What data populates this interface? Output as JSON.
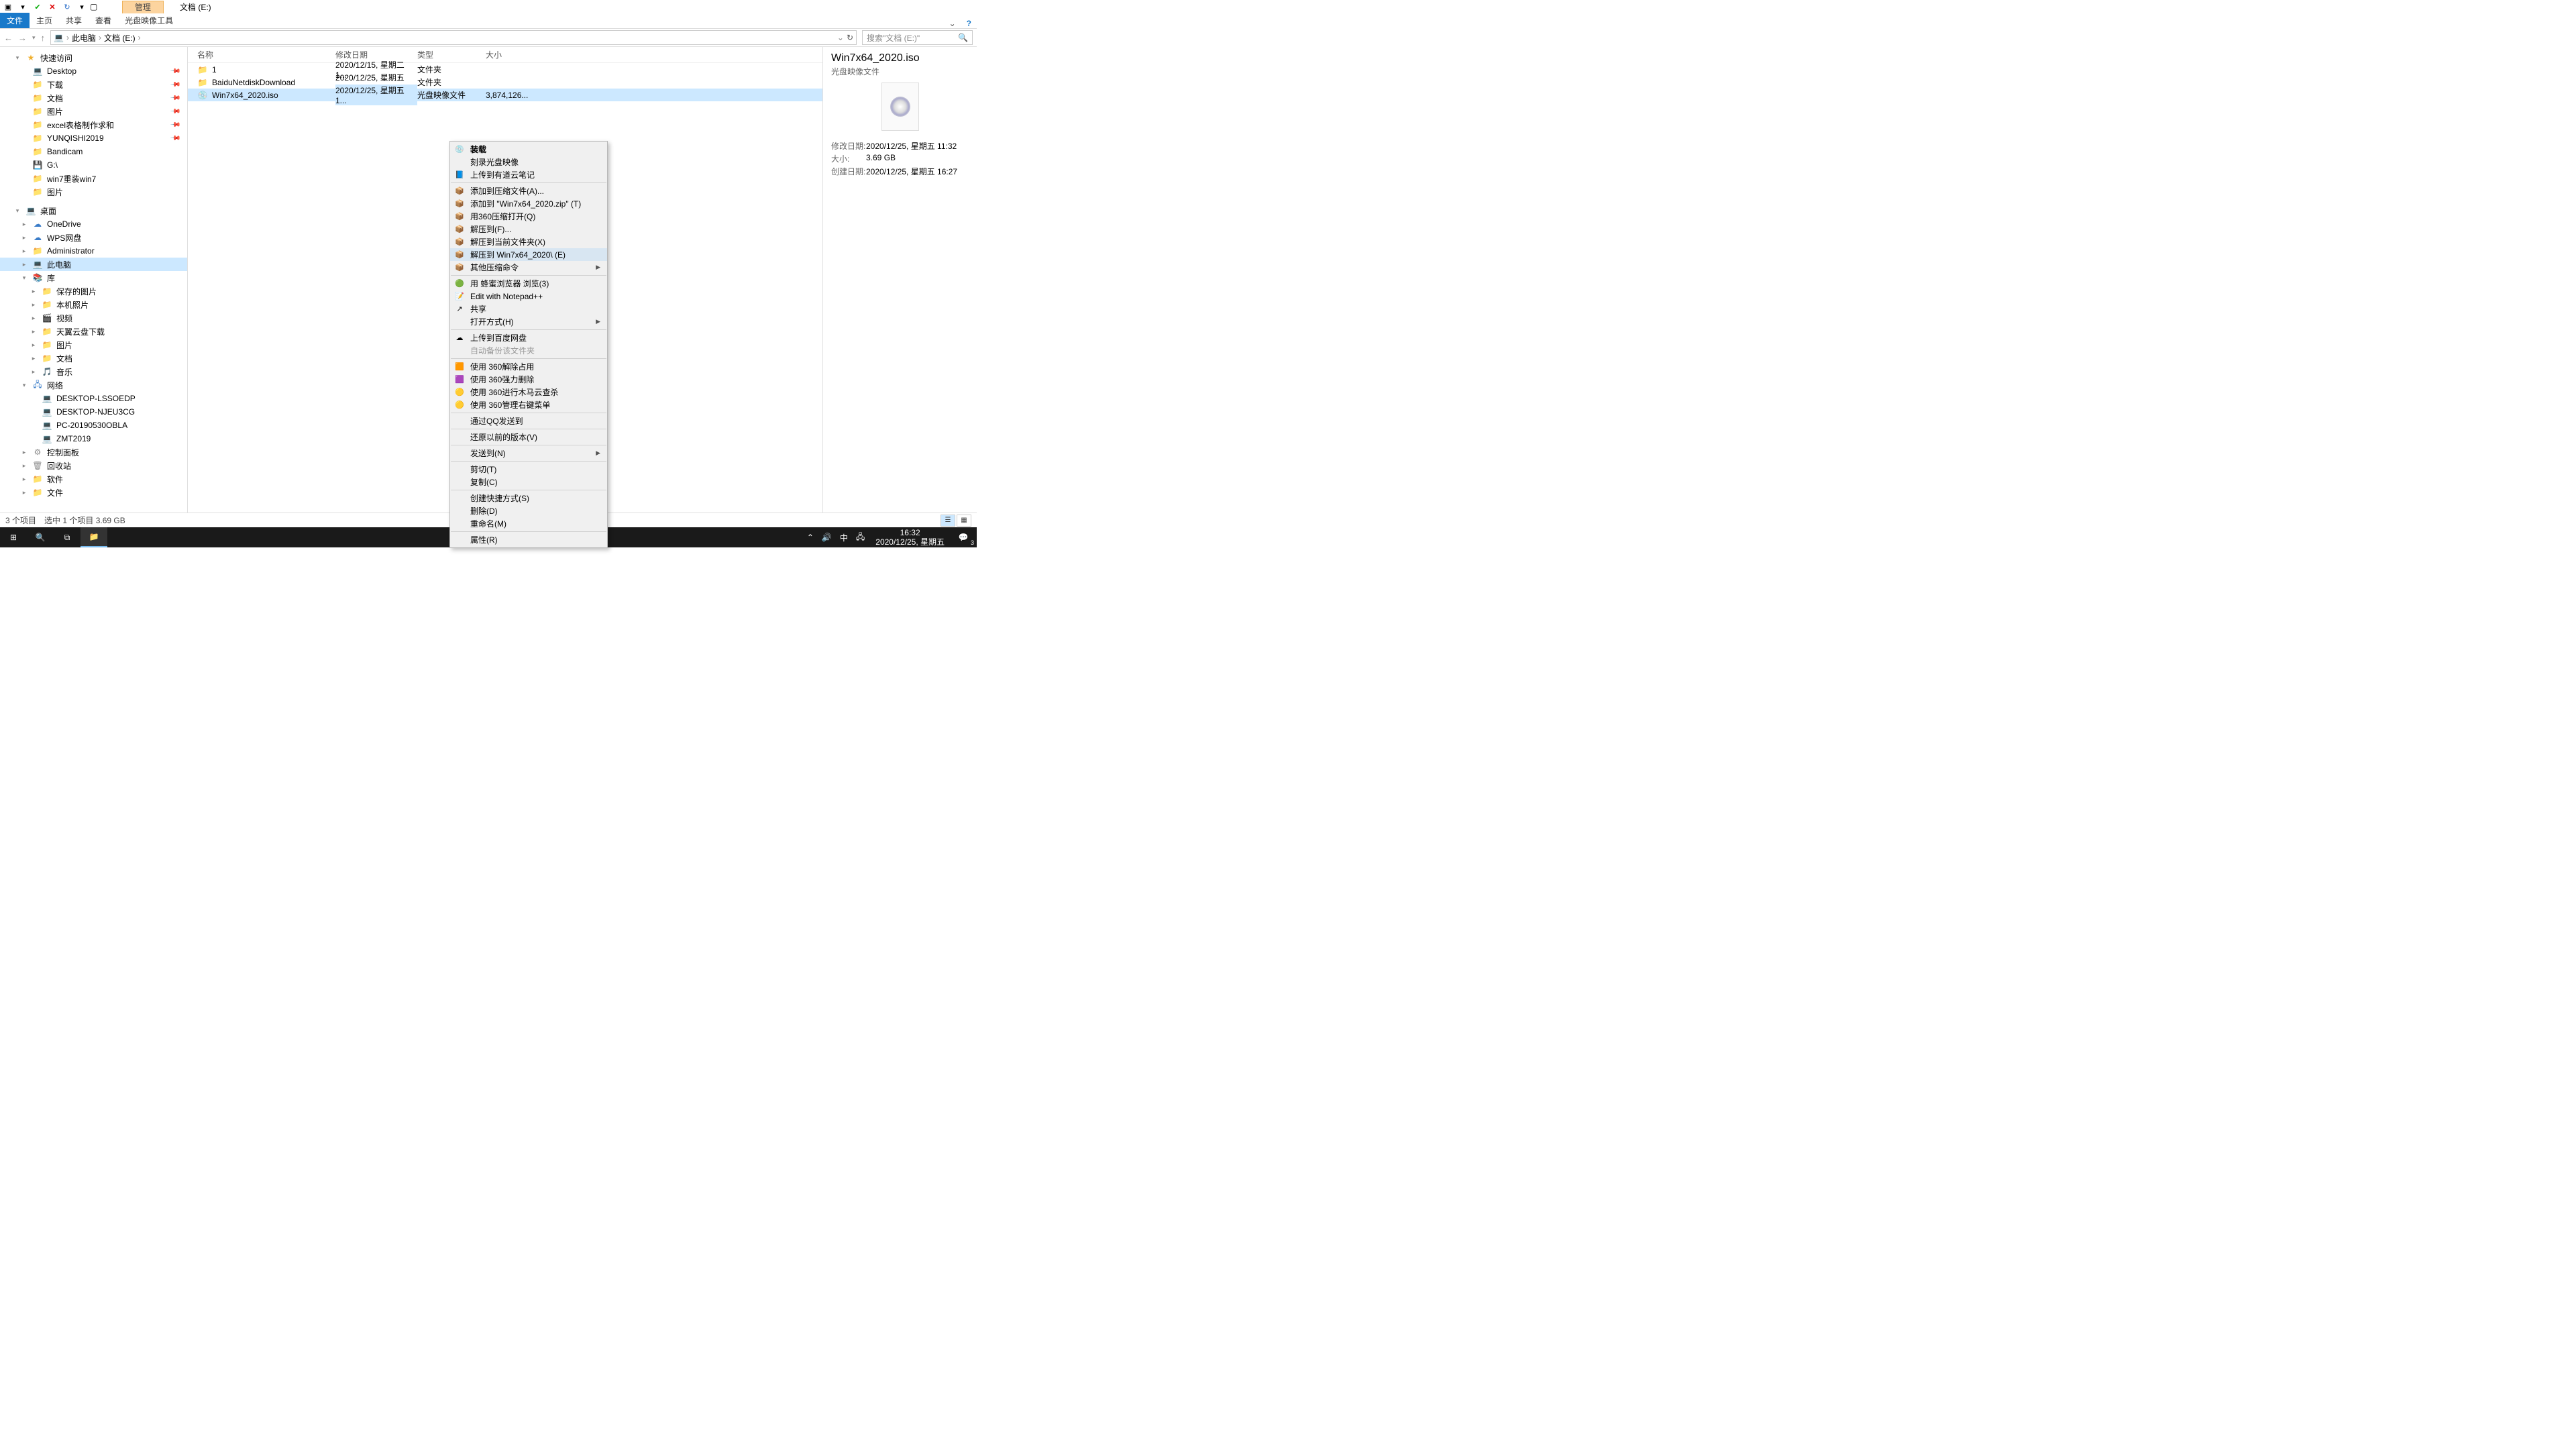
{
  "window_title": "文档 (E:)",
  "ribbon": {
    "context_group": "管理",
    "file": "文件",
    "tabs": [
      "主页",
      "共享",
      "查看"
    ],
    "context_tab": "光盘映像工具"
  },
  "breadcrumb": [
    "此电脑",
    "文档 (E:)"
  ],
  "search_placeholder": "搜索\"文档 (E:)\"",
  "columns": {
    "name": "名称",
    "date": "修改日期",
    "type": "类型",
    "size": "大小"
  },
  "files": [
    {
      "icon": "folder",
      "name": "1",
      "date": "2020/12/15, 星期二 1...",
      "type": "文件夹",
      "size": ""
    },
    {
      "icon": "folder",
      "name": "BaiduNetdiskDownload",
      "date": "2020/12/25, 星期五 1...",
      "type": "文件夹",
      "size": ""
    },
    {
      "icon": "disc",
      "name": "Win7x64_2020.iso",
      "date": "2020/12/25, 星期五 1...",
      "type": "光盘映像文件",
      "size": "3,874,126...",
      "selected": true
    }
  ],
  "sidebar": {
    "quick": {
      "label": "快速访问",
      "items": [
        {
          "label": "Desktop",
          "icon": "monitor",
          "pinned": true
        },
        {
          "label": "下载",
          "icon": "folder",
          "pinned": true
        },
        {
          "label": "文档",
          "icon": "folder",
          "pinned": true
        },
        {
          "label": "图片",
          "icon": "folder",
          "pinned": true
        },
        {
          "label": "excel表格制作求和",
          "icon": "folder",
          "pinned": true
        },
        {
          "label": "YUNQISHI2019",
          "icon": "folder",
          "pinned": true
        },
        {
          "label": "Bandicam",
          "icon": "folder"
        },
        {
          "label": "G:\\",
          "icon": "drive"
        },
        {
          "label": "win7重装win7",
          "icon": "folder"
        },
        {
          "label": "图片",
          "icon": "folder"
        }
      ]
    },
    "desktop": {
      "label": "桌面",
      "items": [
        {
          "label": "OneDrive",
          "icon": "cloud"
        },
        {
          "label": "WPS网盘",
          "icon": "cloud"
        },
        {
          "label": "Administrator",
          "icon": "folder"
        },
        {
          "label": "此电脑",
          "icon": "monitor",
          "selected": true
        },
        {
          "label": "库",
          "icon": "lib"
        }
      ]
    },
    "lib_items": [
      {
        "label": "保存的图片",
        "icon": "folder"
      },
      {
        "label": "本机照片",
        "icon": "folder"
      },
      {
        "label": "视频",
        "icon": "video"
      },
      {
        "label": "天翼云盘下载",
        "icon": "folder"
      },
      {
        "label": "图片",
        "icon": "folder"
      },
      {
        "label": "文档",
        "icon": "folder"
      },
      {
        "label": "音乐",
        "icon": "music"
      }
    ],
    "network": {
      "label": "网络",
      "items": [
        {
          "label": "DESKTOP-LSSOEDP",
          "icon": "monitor"
        },
        {
          "label": "DESKTOP-NJEU3CG",
          "icon": "monitor"
        },
        {
          "label": "PC-20190530OBLA",
          "icon": "monitor"
        },
        {
          "label": "ZMT2019",
          "icon": "monitor"
        }
      ]
    },
    "extra": [
      {
        "label": "控制面板",
        "icon": "panel"
      },
      {
        "label": "回收站",
        "icon": "bin"
      },
      {
        "label": "软件",
        "icon": "folder"
      },
      {
        "label": "文件",
        "icon": "folder"
      }
    ]
  },
  "context_menu": [
    {
      "label": "装载",
      "icon": "💿",
      "first": true
    },
    {
      "label": "刻录光盘映像"
    },
    {
      "label": "上传到有道云笔记",
      "icon": "📘"
    },
    {
      "sep": true
    },
    {
      "label": "添加到压缩文件(A)...",
      "icon": "📦"
    },
    {
      "label": "添加到 \"Win7x64_2020.zip\" (T)",
      "icon": "📦"
    },
    {
      "label": "用360压缩打开(Q)",
      "icon": "📦"
    },
    {
      "label": "解压到(F)...",
      "icon": "📦"
    },
    {
      "label": "解压到当前文件夹(X)",
      "icon": "📦"
    },
    {
      "label": "解压到 Win7x64_2020\\ (E)",
      "icon": "📦",
      "hover": true
    },
    {
      "label": "其他压缩命令",
      "icon": "📦",
      "arrow": true
    },
    {
      "sep": true
    },
    {
      "label": "用 蜂蜜浏览器 浏览(3)",
      "icon": "🟢"
    },
    {
      "label": "Edit with Notepad++",
      "icon": "📝"
    },
    {
      "label": "共享",
      "icon": "↗"
    },
    {
      "label": "打开方式(H)",
      "arrow": true
    },
    {
      "sep": true
    },
    {
      "label": "上传到百度网盘",
      "icon": "☁"
    },
    {
      "label": "自动备份该文件夹",
      "disabled": true
    },
    {
      "sep": true
    },
    {
      "label": "使用 360解除占用",
      "icon": "🟧"
    },
    {
      "label": "使用 360强力删除",
      "icon": "🟪"
    },
    {
      "label": "使用 360进行木马云查杀",
      "icon": "🟡"
    },
    {
      "label": "使用 360管理右键菜单",
      "icon": "🟡"
    },
    {
      "sep": true
    },
    {
      "label": "通过QQ发送到"
    },
    {
      "sep": true
    },
    {
      "label": "还原以前的版本(V)"
    },
    {
      "sep": true
    },
    {
      "label": "发送到(N)",
      "arrow": true
    },
    {
      "sep": true
    },
    {
      "label": "剪切(T)"
    },
    {
      "label": "复制(C)"
    },
    {
      "sep": true
    },
    {
      "label": "创建快捷方式(S)"
    },
    {
      "label": "删除(D)"
    },
    {
      "label": "重命名(M)"
    },
    {
      "sep": true
    },
    {
      "label": "属性(R)"
    }
  ],
  "details": {
    "title": "Win7x64_2020.iso",
    "type": "光盘映像文件",
    "rows": [
      {
        "label": "修改日期:",
        "value": "2020/12/25, 星期五 11:32"
      },
      {
        "label": "大小:",
        "value": "3.69 GB"
      },
      {
        "label": "创建日期:",
        "value": "2020/12/25, 星期五 16:27"
      }
    ]
  },
  "status": {
    "count": "3 个项目",
    "selection": "选中 1 个项目  3.69 GB"
  },
  "taskbar": {
    "time": "16:32",
    "date": "2020/12/25, 星期五",
    "ime": "中",
    "notif": "3"
  }
}
